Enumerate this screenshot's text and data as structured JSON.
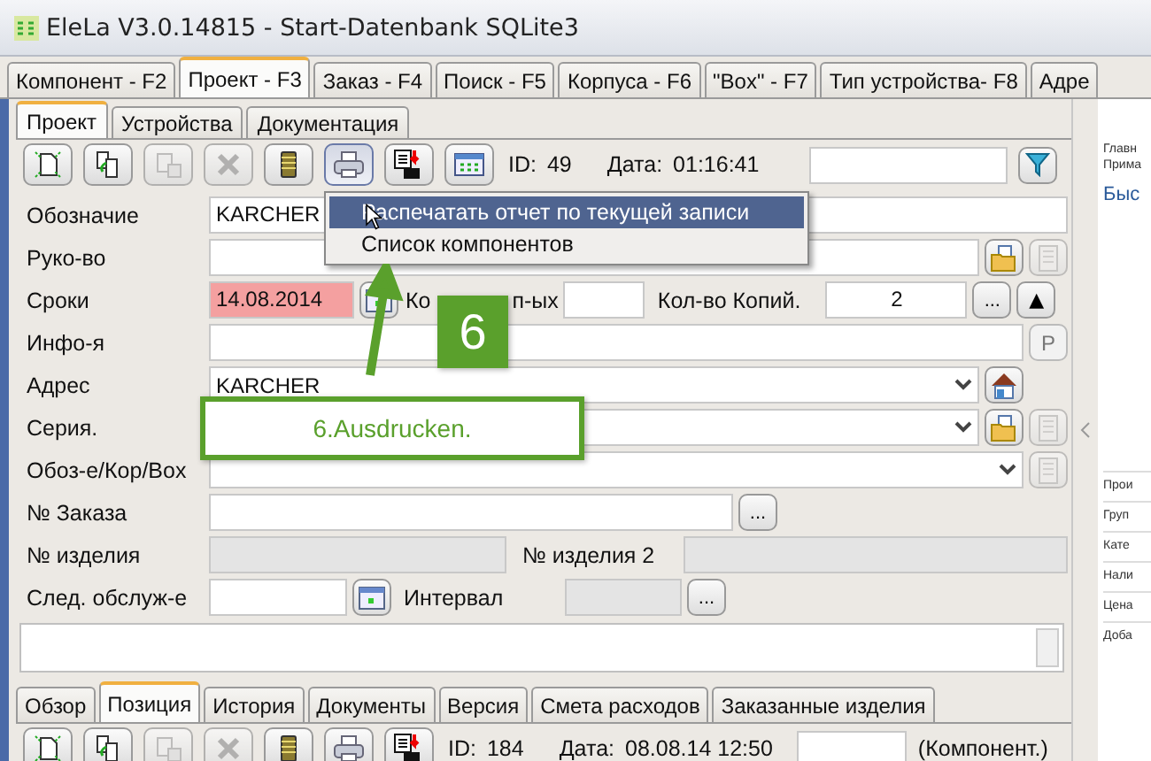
{
  "window": {
    "title": "EleLa V3.0.14815  - Start-Datenbank SQLite3"
  },
  "main_tabs": [
    {
      "label": "Компонент - F2",
      "selected": false
    },
    {
      "label": "Проект - F3",
      "selected": true
    },
    {
      "label": "Заказ - F4",
      "selected": false
    },
    {
      "label": "Поиск - F5",
      "selected": false
    },
    {
      "label": "Корпуса - F6",
      "selected": false
    },
    {
      "label": "\"Box\" - F7",
      "selected": false
    },
    {
      "label": "Тип устройства- F8",
      "selected": false
    },
    {
      "label": "Адре",
      "selected": false
    }
  ],
  "sub_tabs": [
    {
      "label": "Проект",
      "selected": true
    },
    {
      "label": "Устройства",
      "selected": false
    },
    {
      "label": "Документация",
      "selected": false
    }
  ],
  "toolbar": {
    "buttons": [
      {
        "kind": "new",
        "disabled": false,
        "pressed": false
      },
      {
        "kind": "copy",
        "disabled": false,
        "pressed": false
      },
      {
        "kind": "paste",
        "disabled": true,
        "pressed": false
      },
      {
        "kind": "delete",
        "disabled": true,
        "pressed": false
      },
      {
        "kind": "archive",
        "disabled": false,
        "pressed": false
      },
      {
        "kind": "print",
        "disabled": false,
        "pressed": true
      },
      {
        "kind": "report",
        "disabled": false,
        "pressed": false
      },
      {
        "kind": "table",
        "disabled": false,
        "pressed": false
      }
    ],
    "id_label": "ID:",
    "id_value": "49",
    "date_label": "Дата:",
    "date_value": "01:16:41"
  },
  "form": [
    {
      "kind": "text",
      "label": "Обозначие",
      "value": "KARCHER"
    },
    {
      "kind": "text-buttons",
      "label": "Руко-во"
    },
    {
      "kind": "dates",
      "label": "Сроки",
      "value": "14.08.2014",
      "overdue": true,
      "label_start": "Ко",
      "label_end": "п-ых",
      "copies_label": "Кол-во Копий.",
      "copies_value": "2",
      "more": "...",
      "up": "▲"
    },
    {
      "kind": "info",
      "label": "Инфо-я",
      "button": "P"
    },
    {
      "kind": "address",
      "label": "Адрес",
      "value": "KARCHER"
    },
    {
      "kind": "series",
      "label": "Серия."
    },
    {
      "kind": "box",
      "label": "Обоз-е/Кор/Box"
    },
    {
      "kind": "order",
      "label": "№ Заказа",
      "more": "..."
    },
    {
      "kind": "serials",
      "label": "№ изделия",
      "label2": "№ изделия 2"
    },
    {
      "kind": "service",
      "label": "След. обслуж-е",
      "label2": "Интервал",
      "more": "..."
    }
  ],
  "menu": [
    {
      "label": "Распечатать отчет по текущей записи",
      "selected": true
    },
    {
      "label": "Список компонентов",
      "selected": false
    }
  ],
  "callout": {
    "step": "6",
    "caption": "6.Ausdrucken."
  },
  "bottom_tabs": [
    {
      "label": "Обзор",
      "selected": false
    },
    {
      "label": "Позиция",
      "selected": true
    },
    {
      "label": "История",
      "selected": false
    },
    {
      "label": "Документы",
      "selected": false
    },
    {
      "label": "Версия",
      "selected": false
    },
    {
      "label": "Смета расходов",
      "selected": false
    },
    {
      "label": "Заказанные изделия",
      "selected": false
    }
  ],
  "bottom_toolbar": {
    "buttons": [
      {
        "kind": "new",
        "disabled": false,
        "pressed": false
      },
      {
        "kind": "copy",
        "disabled": false,
        "pressed": false
      },
      {
        "kind": "paste",
        "disabled": true,
        "pressed": false
      },
      {
        "kind": "delete",
        "disabled": true,
        "pressed": false
      },
      {
        "kind": "archive",
        "disabled": false,
        "pressed": false
      },
      {
        "kind": "print",
        "disabled": false,
        "pressed": false
      },
      {
        "kind": "report",
        "disabled": false,
        "pressed": false
      }
    ],
    "id_label": "ID:",
    "id_value": "184",
    "date_label": "Дата:",
    "date_value": "08.08.14 12:50",
    "component": "(Компонент.)"
  },
  "side_panel": {
    "top": [
      "Главн",
      "Прима"
    ],
    "heading": "Быс",
    "rows": [
      "Прои",
      "Груп",
      "Кате",
      "Нали",
      "Цена",
      "Доба"
    ]
  }
}
